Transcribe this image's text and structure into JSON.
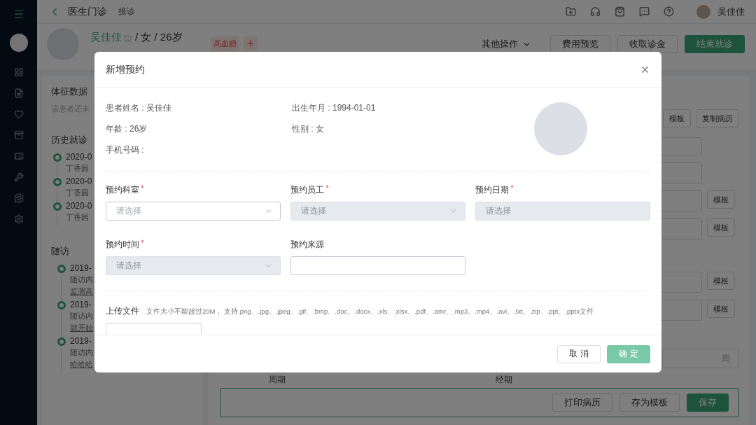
{
  "header": {
    "title": "医生门诊",
    "subtitle": "接诊",
    "user_name": "吴佳佳"
  },
  "patient": {
    "name": "吴佳佳",
    "details": "/ 女 / 26岁",
    "tags": [
      {
        "label": "高血糖"
      }
    ],
    "actions": [
      {
        "label": "其他操作",
        "kind": "dropdown"
      },
      {
        "label": "费用预览",
        "kind": "outline"
      },
      {
        "label": "收取诊金",
        "kind": "outline"
      },
      {
        "label": "结束就诊",
        "kind": "primary"
      }
    ]
  },
  "left_panel": {
    "vitals": {
      "title": "体征数据",
      "note": "该患者还未"
    },
    "history": {
      "title": "历史就诊",
      "items": [
        {
          "date": "2020-0",
          "place": "丁香园"
        },
        {
          "date": "2020-0",
          "place": "丁香园"
        },
        {
          "date": "2020-0",
          "place": "丁香园"
        }
      ]
    },
    "followups": {
      "title": "随访",
      "items": [
        {
          "date": "2019-",
          "content": "随访内",
          "link": "监测高"
        },
        {
          "date": "2019-",
          "content": "随访内",
          "link": "就开始"
        },
        {
          "date": "2019-",
          "content": "随访内",
          "link": "哈哈哈"
        }
      ]
    }
  },
  "right_panel": {
    "top_buttons": [
      "模板",
      "复制病历"
    ],
    "sections": [
      {
        "rows": [
          {
            "kind": "input"
          },
          {
            "kind": "area"
          },
          {
            "kind": "area",
            "button": "模板"
          },
          {
            "kind": "area",
            "button": "模板"
          }
        ]
      },
      {
        "rows": [
          {
            "kind": "area",
            "button": "模板"
          },
          {
            "kind": "area",
            "button": "模板"
          }
        ]
      }
    ],
    "unit": "周",
    "cycle_labels": [
      "周期",
      "经期"
    ],
    "bottom_buttons": [
      {
        "label": "打印病历",
        "kind": "outline"
      },
      {
        "label": "存为模板",
        "kind": "outline"
      },
      {
        "label": "保存",
        "kind": "primary"
      }
    ]
  },
  "modal": {
    "title": "新增预约",
    "info": [
      "患者姓名 : 吴佳佳",
      "出生年月 : 1994-01-01",
      "年龄 : 26岁",
      "性别 : 女",
      "手机号码 :"
    ],
    "fields": [
      {
        "label": "预约科室",
        "required": true,
        "kind": "select",
        "placeholder": "请选择",
        "disabled": false
      },
      {
        "label": "预约员工",
        "required": true,
        "kind": "select",
        "placeholder": "请选择",
        "disabled": true
      },
      {
        "label": "预约日期",
        "required": true,
        "kind": "date",
        "placeholder": "请选择",
        "disabled": true
      },
      {
        "label": "预约时间",
        "required": true,
        "kind": "select",
        "placeholder": "请选择",
        "disabled": true
      },
      {
        "label": "预约来源",
        "required": false,
        "kind": "text",
        "disabled": false
      }
    ],
    "upload": {
      "label": "上传文件",
      "hint": "文件大小不能超过20M， 支持.png、.jpg、.jpeg、.gif、.bmp、.doc、.docx、.xls、.xlsx、.pdf、.amr、.mp3、.mp4、.avi、.txt、.zip、.ppt、.pptx文件"
    },
    "buttons": [
      {
        "label": "取 消",
        "kind": "default"
      },
      {
        "label": "确 定",
        "kind": "primary"
      }
    ]
  }
}
